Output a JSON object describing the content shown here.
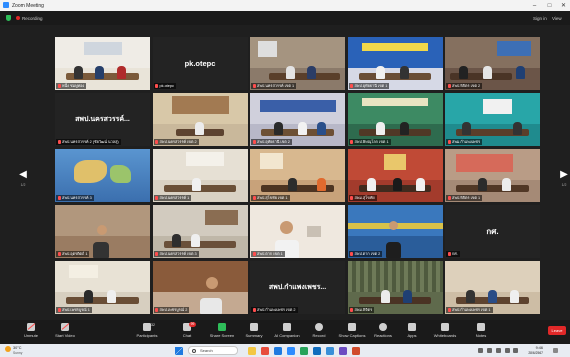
{
  "window": {
    "title": "Zoom Meeting",
    "minimize": "–",
    "maximize": "□",
    "close": "✕"
  },
  "topbar": {
    "recording_label": "Recording",
    "sign_in": "Sign in",
    "view": "View"
  },
  "gallery": {
    "page_left": "1/2",
    "page_right": "1/2",
    "tiles": [
      {
        "name": "หนึ่ง ชมพู่ทอง",
        "big": ""
      },
      {
        "name": "pk.otepc",
        "big": "pk.otepc"
      },
      {
        "name": "สพป.นครสวรรค์ เขต 1",
        "big": ""
      },
      {
        "name": "สพป.อุทัยธานี เขต 1",
        "big": ""
      },
      {
        "name": "สพป.พิจิตร เขต 2",
        "big": ""
      },
      {
        "name": "สพป.นครสวรรค์ 2 (ชัยวัฒน์ นวลสุ)",
        "big": "สพป.นครสวรรค์..."
      },
      {
        "name": "สพป.นครสวรรค์ เขต 2",
        "big": ""
      },
      {
        "name": "สพป.อุทัยธานี เขต 2",
        "big": ""
      },
      {
        "name": "สพป.พิษณุโลก เขต 1",
        "big": ""
      },
      {
        "name": "สพม.กำแพงเพชร",
        "big": ""
      },
      {
        "name": "สพป.นครสวรรค์ 3",
        "big": ""
      },
      {
        "name": "สพป.นครสวรรค์ 1",
        "big": ""
      },
      {
        "name": "สพป.สุโขทัย เขต 1",
        "big": ""
      },
      {
        "name": "สพม.สุโขทัย",
        "big": ""
      },
      {
        "name": "สพป.พิจิตร เขต 1",
        "big": ""
      },
      {
        "name": "สพป.อุตรดิตถ์ 1",
        "big": ""
      },
      {
        "name": "สพป.นครสวรรค์ เขต 3",
        "big": ""
      },
      {
        "name": "สพป.ตาก เขต 1",
        "big": ""
      },
      {
        "name": "สพป.ตาก เขต 2",
        "big": ""
      },
      {
        "name": "กศ.",
        "big": "กศ."
      },
      {
        "name": "สพป.เพชรบูรณ์ 1",
        "big": ""
      },
      {
        "name": "สพป.เพชรบูรณ์ 2",
        "big": ""
      },
      {
        "name": "สพป.กำแพงเพชร เขต 2",
        "big": "สพป.กำแพงเพชร..."
      },
      {
        "name": "สพม.พิจิตร",
        "big": ""
      },
      {
        "name": "สพป.กำแพงเพชร เขต 1",
        "big": ""
      }
    ]
  },
  "toolbar": {
    "unmute": "Unmute",
    "start_video": "Start Video",
    "participants": "Participants",
    "participants_count": "32",
    "chat": "Chat",
    "chat_badge": "99",
    "share_screen": "Share Screen",
    "summary": "Summary",
    "ai_companion": "AI Companion",
    "record": "Record",
    "show_captions": "Show Captions",
    "reactions": "Reactions",
    "apps": "Apps",
    "whiteboards": "Whiteboards",
    "notes": "Notes",
    "leave": "Leave"
  },
  "taskbar": {
    "temperature": "30°C",
    "condition": "Sunny",
    "search_placeholder": "Search",
    "time": "9:46",
    "date": "28/6/2567"
  }
}
